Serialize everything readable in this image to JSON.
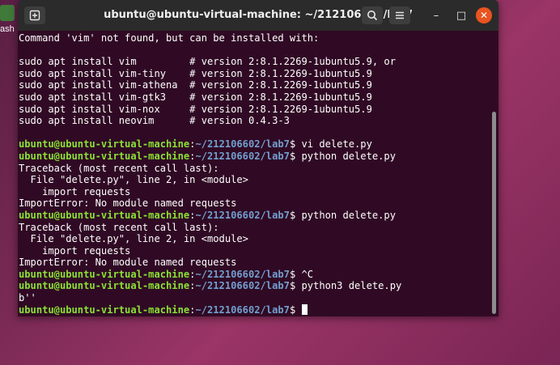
{
  "desktop": {
    "label": "ash"
  },
  "window": {
    "title": "ubuntu@ubuntu-virtual-machine: ~/212106602/lab7",
    "new_tab_icon": "new-tab-icon",
    "search_icon": "search-icon",
    "menu_icon": "hamburger-menu-icon",
    "minimize": "–",
    "maximize": "□",
    "close": "✕"
  },
  "prompt": {
    "user": "ubuntu@ubuntu-virtual-machine",
    "path": "~/212106602/lab7",
    "symbol": "$"
  },
  "lines": [
    {
      "text": "Command 'vim' not found, but can be installed with:"
    },
    {
      "text": ""
    },
    {
      "text": "sudo apt install vim         # version 2:8.1.2269-1ubuntu5.9, or"
    },
    {
      "text": "sudo apt install vim-tiny    # version 2:8.1.2269-1ubuntu5.9"
    },
    {
      "text": "sudo apt install vim-athena  # version 2:8.1.2269-1ubuntu5.9"
    },
    {
      "text": "sudo apt install vim-gtk3    # version 2:8.1.2269-1ubuntu5.9"
    },
    {
      "text": "sudo apt install vim-nox     # version 2:8.1.2269-1ubuntu5.9"
    },
    {
      "text": "sudo apt install neovim      # version 0.4.3-3"
    },
    {
      "text": ""
    },
    {
      "prompt": true,
      "cmd": " vi delete.py"
    },
    {
      "prompt": true,
      "cmd": " python delete.py"
    },
    {
      "text": "Traceback (most recent call last):"
    },
    {
      "text": "  File \"delete.py\", line 2, in <module>"
    },
    {
      "text": "    import requests"
    },
    {
      "text": "ImportError: No module named requests"
    },
    {
      "prompt": true,
      "cmd": " python delete.py"
    },
    {
      "text": "Traceback (most recent call last):"
    },
    {
      "text": "  File \"delete.py\", line 2, in <module>"
    },
    {
      "text": "    import requests"
    },
    {
      "text": "ImportError: No module named requests"
    },
    {
      "prompt": true,
      "cmd": " ^C"
    },
    {
      "prompt": true,
      "cmd": " python3 delete.py"
    },
    {
      "text": "b''"
    },
    {
      "prompt": true,
      "cmd": " ",
      "cursor": true
    }
  ]
}
